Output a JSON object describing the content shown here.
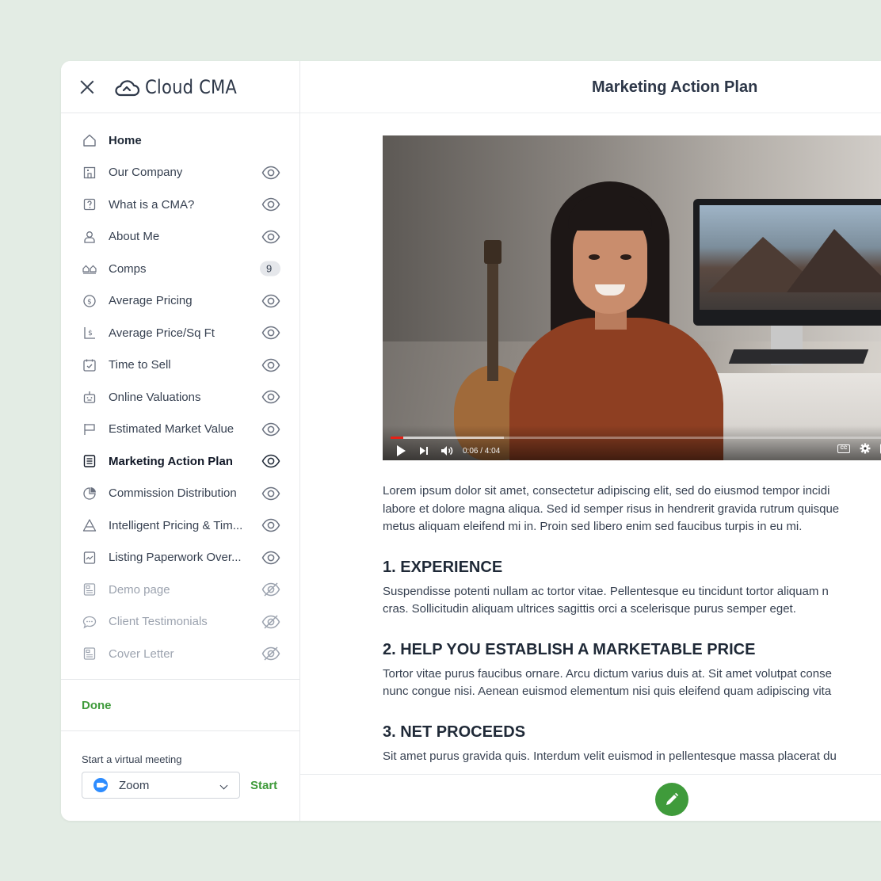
{
  "app": {
    "name": "Cloud CMA"
  },
  "sidebar": {
    "items": [
      {
        "label": "Home",
        "icon": "home-icon",
        "state": "home"
      },
      {
        "label": "Our Company",
        "icon": "building-icon",
        "state": "visible"
      },
      {
        "label": "What is a CMA?",
        "icon": "question-icon",
        "state": "visible"
      },
      {
        "label": "About Me",
        "icon": "user-icon",
        "state": "visible"
      },
      {
        "label": "Comps",
        "icon": "houses-icon",
        "state": "badge",
        "badge": "9"
      },
      {
        "label": "Average Pricing",
        "icon": "dollar-icon",
        "state": "visible"
      },
      {
        "label": "Average Price/Sq Ft",
        "icon": "price-sqft-icon",
        "state": "visible"
      },
      {
        "label": "Time to Sell",
        "icon": "calendar-check-icon",
        "state": "visible"
      },
      {
        "label": "Online Valuations",
        "icon": "robot-icon",
        "state": "visible"
      },
      {
        "label": "Estimated Market Value",
        "icon": "flag-icon",
        "state": "visible"
      },
      {
        "label": "Marketing Action Plan",
        "icon": "list-icon",
        "state": "active"
      },
      {
        "label": "Commission Distribution",
        "icon": "pie-icon",
        "state": "visible"
      },
      {
        "label": "Intelligent Pricing & Tim...",
        "icon": "triangle-icon",
        "state": "visible"
      },
      {
        "label": "Listing Paperwork Over...",
        "icon": "document-icon",
        "state": "visible"
      },
      {
        "label": "Demo page",
        "icon": "page-icon",
        "state": "hidden"
      },
      {
        "label": "Client Testimonials",
        "icon": "chat-icon",
        "state": "hidden"
      },
      {
        "label": "Cover Letter",
        "icon": "page-icon",
        "state": "hidden"
      }
    ],
    "done_label": "Done",
    "meeting": {
      "label": "Start a virtual meeting",
      "selected": "Zoom",
      "start_label": "Start"
    }
  },
  "main": {
    "title": "Marketing Action Plan",
    "video": {
      "time": "0:06 / 4:04",
      "progress": 0.025,
      "buffered": 0.23
    },
    "intro": [
      "Lorem ipsum dolor sit amet, consectetur adipiscing elit, sed do eiusmod tempor incidi",
      "labore et dolore magna aliqua. Sed id semper risus in hendrerit gravida rutrum quisque",
      "metus aliquam eleifend mi in. Proin sed libero enim sed faucibus turpis in eu mi."
    ],
    "sections": [
      {
        "heading": "1. EXPERIENCE",
        "lines": [
          " Suspendisse potenti nullam ac tortor vitae. Pellentesque eu tincidunt tortor aliquam n",
          "cras. Sollicitudin aliquam ultrices sagittis orci a scelerisque purus semper eget."
        ]
      },
      {
        "heading": "2. HELP YOU ESTABLISH A MARKETABLE PRICE",
        "lines": [
          "Tortor vitae purus faucibus ornare. Arcu dictum varius duis at. Sit amet volutpat conse",
          "nunc congue nisi. Aenean euismod elementum nisi quis eleifend quam adipiscing vita"
        ]
      },
      {
        "heading": "3. NET PROCEEDS",
        "lines": [
          "Sit amet purus gravida quis. Interdum velit euismod in pellentesque massa placerat du"
        ]
      }
    ]
  },
  "colors": {
    "accent": "#3f9b3b",
    "zoom": "#2d8cff",
    "progress": "#e62117"
  }
}
